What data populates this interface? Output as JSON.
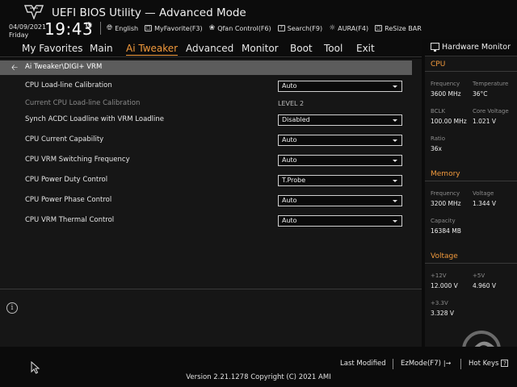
{
  "header": {
    "title": "UEFI BIOS Utility — Advanced Mode",
    "date": "04/09/2021",
    "day": "Friday",
    "time": "19:43",
    "toolbar": [
      {
        "icon": "globe-icon",
        "label": "English"
      },
      {
        "icon": "my-favorite-icon",
        "label": "MyFavorite(F3)"
      },
      {
        "icon": "fan-icon",
        "label": "Qfan Control(F6)"
      },
      {
        "icon": "search-icon",
        "label": "Search(F9)"
      },
      {
        "icon": "aura-icon",
        "label": "AURA(F4)"
      },
      {
        "icon": "resize-bar-icon",
        "label": "ReSize BAR"
      }
    ]
  },
  "nav": {
    "tabs": [
      "My Favorites",
      "Main",
      "Ai Tweaker",
      "Advanced",
      "Monitor",
      "Boot",
      "Tool",
      "Exit"
    ],
    "active": "Ai Tweaker"
  },
  "main": {
    "breadcrumb": "Ai Tweaker\\DIGI+ VRM",
    "rows": [
      {
        "label": "CPU Load-line Calibration",
        "type": "select",
        "value": "Auto"
      },
      {
        "label": "Current CPU Load-line Calibration",
        "type": "static",
        "value": "LEVEL 2"
      },
      {
        "label": "Synch ACDC Loadline with VRM Loadline",
        "type": "select",
        "value": "Disabled"
      },
      {
        "label": "CPU Current Capability",
        "type": "select",
        "value": "Auto"
      },
      {
        "label": "CPU VRM Switching Frequency",
        "type": "select",
        "value": "Auto"
      },
      {
        "label": "CPU Power Duty Control",
        "type": "select",
        "value": "T.Probe"
      },
      {
        "label": "CPU Power Phase Control",
        "type": "select",
        "value": "Auto"
      },
      {
        "label": "CPU VRM Thermal Control",
        "type": "select",
        "value": "Auto"
      }
    ]
  },
  "hardware_monitor": {
    "title": "Hardware Monitor",
    "cpu": {
      "section": "CPU",
      "frequency_label": "Frequency",
      "frequency": "3600 MHz",
      "temperature_label": "Temperature",
      "temperature": "36°C",
      "bclk_label": "BCLK",
      "bclk": "100.00 MHz",
      "core_voltage_label": "Core Voltage",
      "core_voltage": "1.021 V",
      "ratio_label": "Ratio",
      "ratio": "36x"
    },
    "memory": {
      "section": "Memory",
      "frequency_label": "Frequency",
      "frequency": "3200 MHz",
      "voltage_label": "Voltage",
      "voltage": "1.344 V",
      "capacity_label": "Capacity",
      "capacity": "16384 MB"
    },
    "voltage": {
      "section": "Voltage",
      "v12_label": "+12V",
      "v12": "12.000 V",
      "v5_label": "+5V",
      "v5": "4.960 V",
      "v33_label": "+3.3V",
      "v33": "3.328 V"
    }
  },
  "footer": {
    "last_modified": "Last Modified",
    "ezmode": "EzMode(F7)",
    "hotkeys": "Hot Keys",
    "version": "Version 2.21.1278 Copyright (C) 2021 AMI"
  },
  "colors": {
    "accent": "#f29a3c",
    "breadcrumb_bg": "#5c5c5c",
    "panel_bg": "#161616"
  }
}
